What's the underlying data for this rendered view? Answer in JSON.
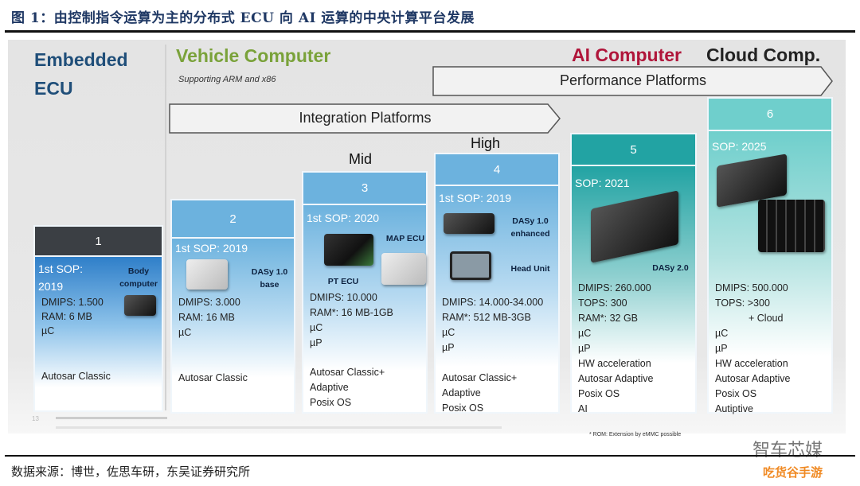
{
  "figure": {
    "title": "图 1：由控制指令运算为主的分布式 ECU 向 AI 运算的中央计算平台发展",
    "source": "数据来源：博世，佐思车研，东吴证券研究所"
  },
  "slide": {
    "eras": {
      "embedded": "Embedded ECU",
      "vehicle": "Vehicle Computer",
      "vehicle_sub": "Supporting ARM and x86",
      "ai": "AI Computer",
      "cloud": "Cloud Comp."
    },
    "arrows": {
      "integration": "Integration Platforms",
      "performance": "Performance Platforms"
    },
    "levels": {
      "mid": "Mid",
      "high": "High"
    },
    "colors": {
      "dark_header": "#3b3f44",
      "blue": "#6cb2de",
      "teal": "#22a3a3",
      "teal_light": "#6fcfcc"
    },
    "columns": [
      {
        "num": "1",
        "sop": "1st SOP: 2019",
        "devices": [
          "Body computer"
        ],
        "specs": [
          "DMIPS: 1.500",
          "RAM: 6 MB",
          "µC"
        ],
        "software": [
          "Autosar Classic"
        ]
      },
      {
        "num": "2",
        "sop": "1st SOP: 2019",
        "devices": [
          "DASy 1.0 base"
        ],
        "specs": [
          "DMIPS: 3.000",
          "RAM: 16 MB",
          "µC"
        ],
        "software": [
          "Autosar Classic"
        ]
      },
      {
        "num": "3",
        "sop": "1st SOP: 2020",
        "devices": [
          "MAP ECU",
          "PT ECU"
        ],
        "specs": [
          "DMIPS: 10.000",
          "RAM*: 16 MB-1GB",
          "µC",
          "µP"
        ],
        "software": [
          "Autosar Classic+",
          "Adaptive",
          "Posix OS"
        ]
      },
      {
        "num": "4",
        "sop": "1st SOP: 2019",
        "devices": [
          "DASy 1.0 enhanced",
          "Head Unit"
        ],
        "specs": [
          "DMIPS: 14.000-34.000",
          "RAM*: 512 MB-3GB",
          "µC",
          "µP"
        ],
        "software": [
          "Autosar Classic+",
          "Adaptive",
          "Posix OS"
        ]
      },
      {
        "num": "5",
        "sop": "SOP: 2021",
        "devices": [
          "DASy 2.0"
        ],
        "specs": [
          "DMIPS: 260.000",
          "TOPS: 300",
          "RAM*: 32 GB",
          "µC",
          "µP",
          "HW acceleration",
          "Autosar Adaptive",
          "Posix OS",
          "AI"
        ]
      },
      {
        "num": "6",
        "sop": "SOP: 2025",
        "devices": [],
        "specs": [
          "DMIPS: 500.000",
          "TOPS: >300",
          "+ Cloud",
          "µC",
          "µP",
          "HW acceleration",
          "Autosar Adaptive",
          "Posix OS",
          "Autiptive"
        ]
      }
    ],
    "footnote": "* ROM: Extension by eMMC possible",
    "page_num": "13"
  },
  "watermarks": [
    "智车芯媒",
    "吃货谷手游"
  ]
}
